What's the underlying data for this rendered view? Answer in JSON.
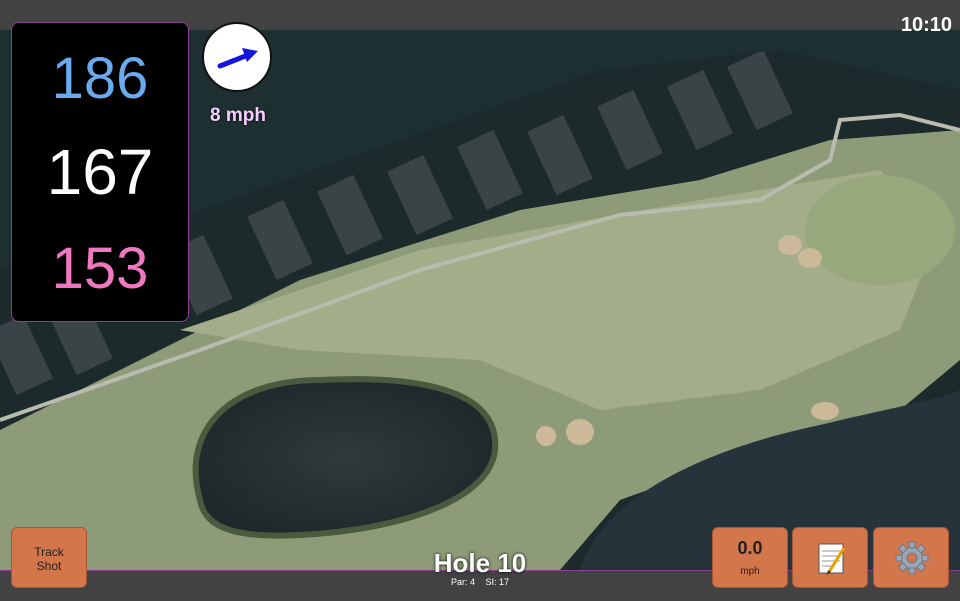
{
  "status": {
    "time": "10:10"
  },
  "yardages": {
    "back": "186",
    "middle": "167",
    "front": "153"
  },
  "wind": {
    "speed": "8 mph",
    "icon": "wind-direction-arrow-icon"
  },
  "buttons": {
    "track_shot": [
      "Track",
      "Shot"
    ],
    "shot_speed_value": "0.0",
    "shot_speed_unit": "mph",
    "notes_icon": "notepad-icon",
    "settings_icon": "gear-icon"
  },
  "hole": {
    "title": "Hole 10",
    "par": "Par: 4",
    "si": "SI: 17"
  },
  "colors": {
    "accent": "#8a3f8f",
    "button": "#d4764b",
    "back": "#6aabf0",
    "front": "#f078c0"
  }
}
